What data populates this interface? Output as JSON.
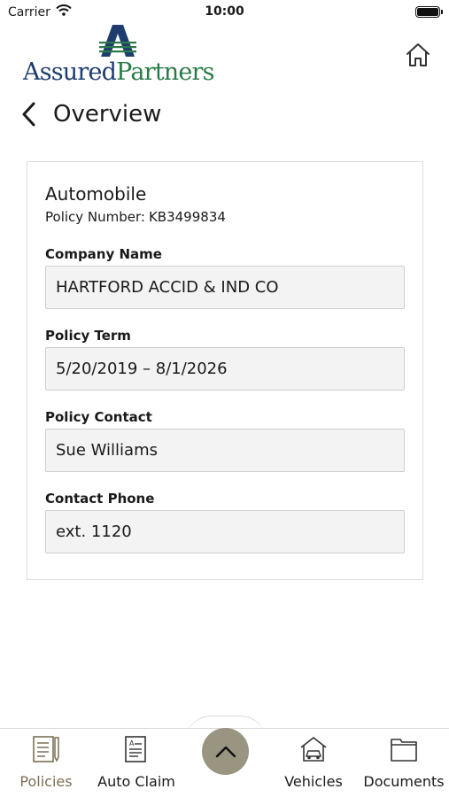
{
  "status": {
    "carrier": "Carrier",
    "time": "10:00"
  },
  "header": {
    "brand_part1": "Assured",
    "brand_part2": "Partners",
    "back_title": "Overview"
  },
  "policy": {
    "type": "Automobile",
    "number_label": "Policy Number:",
    "number": "KB3499834",
    "fields": [
      {
        "label": "Company Name",
        "value": "HARTFORD ACCID & IND CO"
      },
      {
        "label": "Policy Term",
        "value": "5/20/2019 – 8/1/2026"
      },
      {
        "label": "Policy Contact",
        "value": "Sue Williams"
      },
      {
        "label": "Contact Phone",
        "value": "ext. 1120"
      }
    ]
  },
  "nav": {
    "items": [
      {
        "label": "Policies",
        "icon": "policies-icon",
        "active": true
      },
      {
        "label": "Auto Claim",
        "icon": "auto-claim-icon"
      },
      {
        "label": "Vehicles",
        "icon": "vehicles-icon"
      },
      {
        "label": "Documents",
        "icon": "documents-icon"
      }
    ],
    "center_icon": "chevron-up-icon"
  },
  "colors": {
    "brand_blue": "#1e3c6e",
    "brand_green": "#2a7a48",
    "active_tab": "#7a6f55",
    "fab": "#9a9580"
  }
}
